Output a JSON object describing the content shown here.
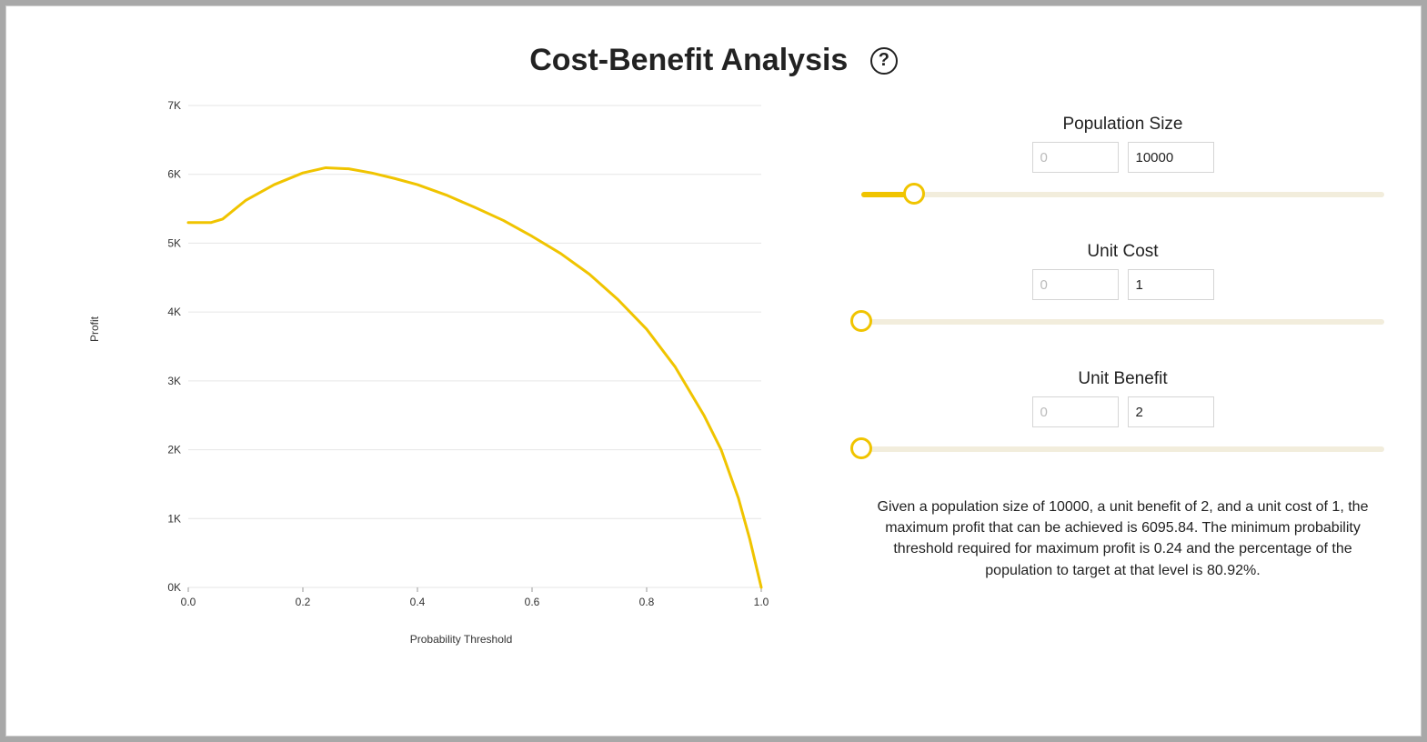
{
  "title": "Cost-Benefit Analysis",
  "help_tooltip": "?",
  "controls": {
    "population": {
      "label": "Population Size",
      "min_placeholder": "0",
      "value": "10000",
      "slider_pct": 10
    },
    "unit_cost": {
      "label": "Unit Cost",
      "min_placeholder": "0",
      "value": "1",
      "slider_pct": 0
    },
    "unit_benefit": {
      "label": "Unit Benefit",
      "min_placeholder": "0",
      "value": "2",
      "slider_pct": 0
    }
  },
  "explanation": "Given a population size of 10000, a unit benefit of 2, and a unit cost of 1, the maximum profit that can be achieved is 6095.84. The minimum probability threshold required for maximum profit is 0.24 and the percentage of the population to target at that level is 80.92%.",
  "chart_data": {
    "type": "line",
    "title": "",
    "xlabel": "Probability Threshold",
    "ylabel": "Profit",
    "xlim": [
      0.0,
      1.0
    ],
    "ylim": [
      0,
      7000
    ],
    "x_ticks": [
      "0.0",
      "0.2",
      "0.4",
      "0.6",
      "0.8",
      "1.0"
    ],
    "y_ticks": [
      "0K",
      "1K",
      "2K",
      "3K",
      "4K",
      "5K",
      "6K",
      "7K"
    ],
    "series": [
      {
        "name": "Profit",
        "color": "#f0c400",
        "x": [
          0.0,
          0.04,
          0.06,
          0.1,
          0.15,
          0.2,
          0.24,
          0.28,
          0.32,
          0.36,
          0.4,
          0.45,
          0.5,
          0.55,
          0.6,
          0.65,
          0.7,
          0.75,
          0.8,
          0.85,
          0.9,
          0.93,
          0.96,
          0.98,
          0.99,
          1.0
        ],
        "values": [
          5300,
          5300,
          5350,
          5620,
          5850,
          6020,
          6096,
          6080,
          6020,
          5940,
          5850,
          5700,
          5520,
          5330,
          5100,
          4850,
          4550,
          4180,
          3750,
          3200,
          2500,
          2000,
          1300,
          700,
          350,
          0
        ]
      }
    ]
  }
}
